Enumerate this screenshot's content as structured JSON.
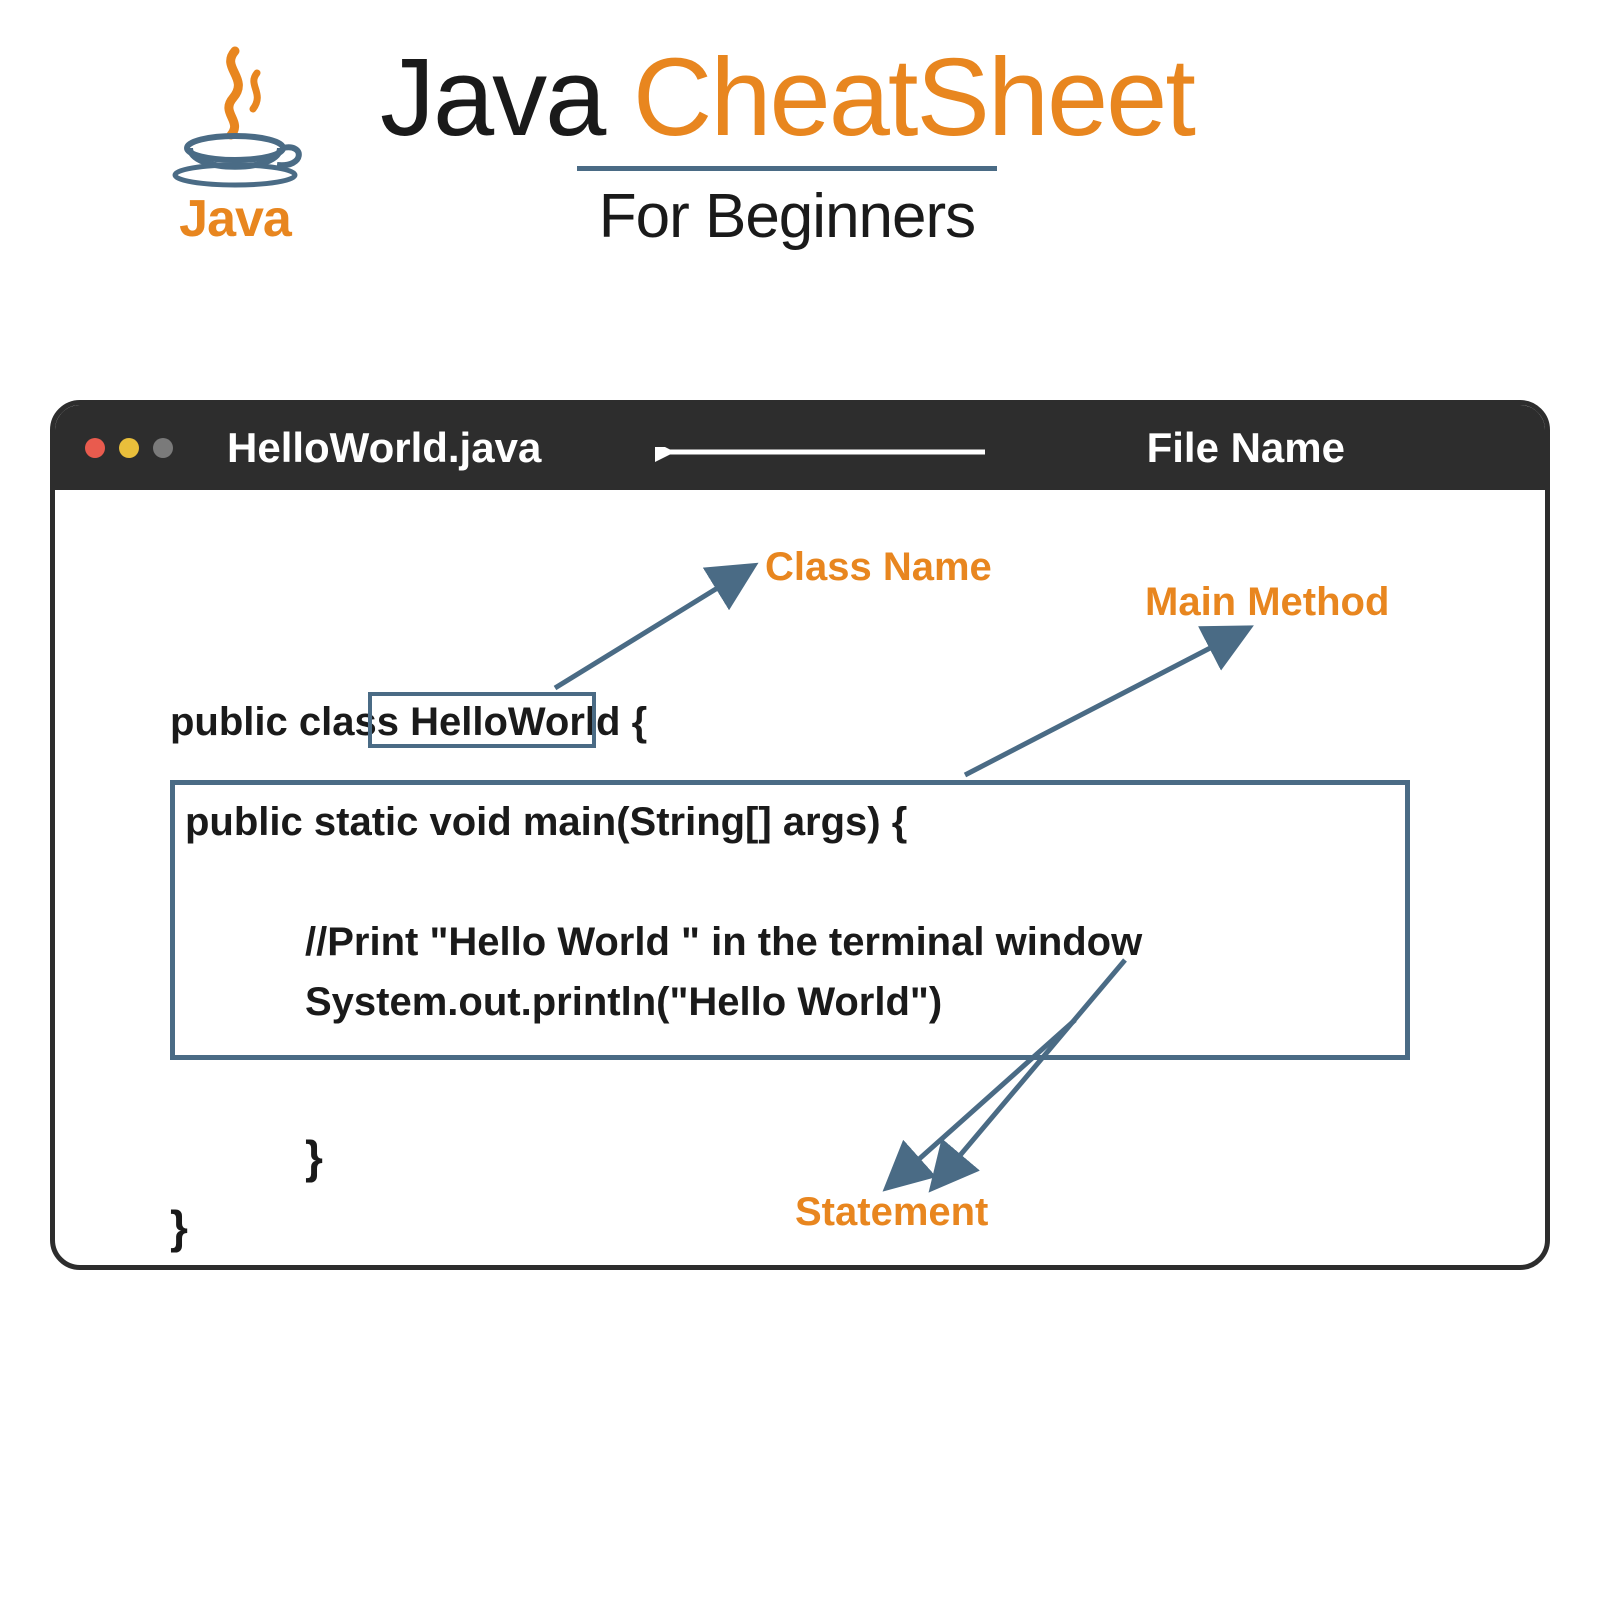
{
  "logo": {
    "text": "Java"
  },
  "title": {
    "word1": "Java",
    "word2": "CheatSheet",
    "subtitle": "For Beginners"
  },
  "window": {
    "filename": "HelloWorld.java",
    "filename_label": "File Name"
  },
  "labels": {
    "class_name": "Class Name",
    "main_method": "Main Method",
    "statement": "Statement"
  },
  "code": {
    "l1": "public class HelloWorld {",
    "l2": "public static void main(String[] args) {",
    "l3": "//Print \"Hello World \" in the terminal window",
    "l4": "System.out.println(\"Hello World\")",
    "l5": "}",
    "l6": "}"
  },
  "colors": {
    "orange": "#e8861f",
    "steel": "#4a6b85",
    "dark": "#2d2d2d"
  }
}
